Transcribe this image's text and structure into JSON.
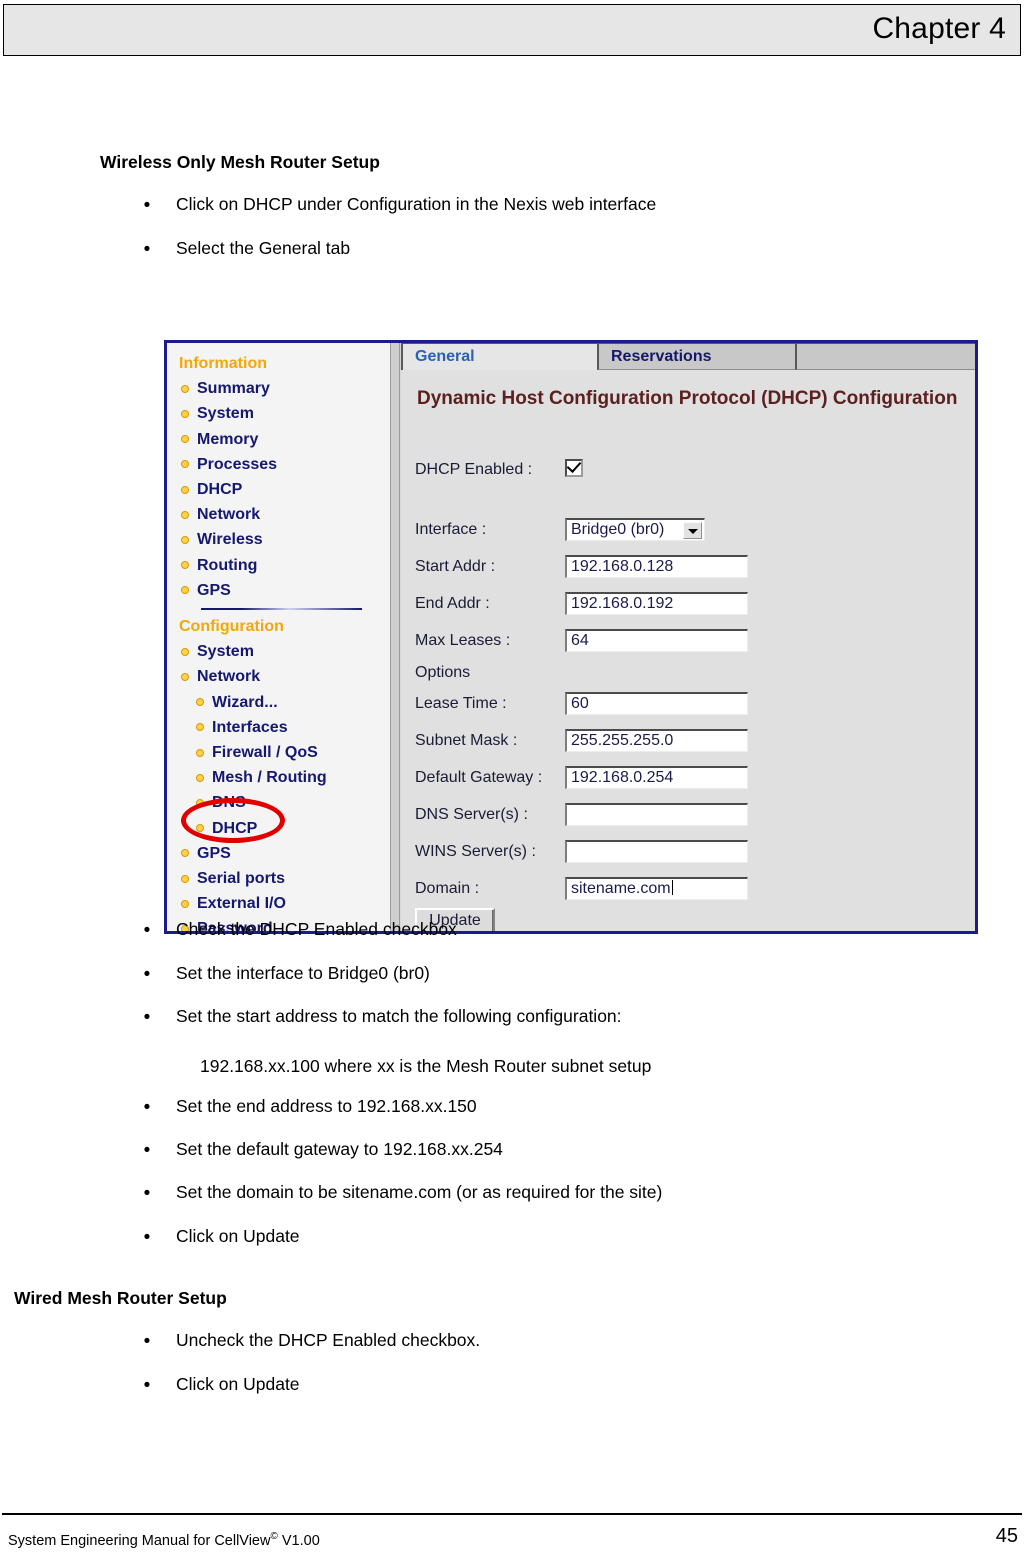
{
  "header": {
    "chapter_label": "Chapter 4"
  },
  "sections": {
    "wireless": {
      "heading": "Wireless Only Mesh Router Setup",
      "pre_bullets": [
        "Click on DHCP under Configuration in the Nexis web interface",
        "Select the General tab"
      ],
      "post_bullets": [
        "Check the DHCP Enabled checkbox",
        "Set the interface to Bridge0 (br0)",
        "Set the start address to match the following configuration:"
      ],
      "sub_note": "192.168.xx.100 where xx is the Mesh Router subnet setup",
      "post_bullets2": [
        "Set the end address to 192.168.xx.150",
        "Set the default gateway to 192.168.xx.254",
        "Set the domain to be sitename.com (or as required for the site)",
        "Click on Update"
      ]
    },
    "wired": {
      "heading": "Wired Mesh Router Setup",
      "bullets": [
        "Uncheck the DHCP Enabled checkbox.",
        "Click on Update"
      ]
    }
  },
  "app_screenshot": {
    "sidebar": {
      "information_title": "Information",
      "information_items": [
        {
          "label": "Summary"
        },
        {
          "label": "System"
        },
        {
          "label": "Memory"
        },
        {
          "label": "Processes"
        },
        {
          "label": "DHCP"
        },
        {
          "label": "Network"
        },
        {
          "label": "Wireless"
        },
        {
          "label": "Routing"
        },
        {
          "label": "GPS"
        }
      ],
      "configuration_title": "Configuration",
      "configuration_items": [
        {
          "label": "System",
          "sub": false
        },
        {
          "label": "Network",
          "sub": false
        },
        {
          "label": "Wizard...",
          "sub": true
        },
        {
          "label": "Interfaces",
          "sub": true
        },
        {
          "label": "Firewall / QoS",
          "sub": true
        },
        {
          "label": "Mesh / Routing",
          "sub": true
        },
        {
          "label": "DNS",
          "sub": true
        },
        {
          "label": "DHCP",
          "sub": true
        },
        {
          "label": "GPS",
          "sub": false
        },
        {
          "label": "Serial ports",
          "sub": false
        },
        {
          "label": "External I/O",
          "sub": false
        },
        {
          "label": "Password",
          "sub": false
        }
      ],
      "annotation_color": "#e00000",
      "annotated_item": "DHCP"
    },
    "tabs": [
      {
        "label": "General",
        "active": true
      },
      {
        "label": "Reservations",
        "active": false
      }
    ],
    "form": {
      "title": "Dynamic Host Configuration Protocol (DHCP) Configuration",
      "dhcp_enabled_label": "DHCP Enabled :",
      "dhcp_enabled_checked": true,
      "interface_label": "Interface :",
      "interface_value": "Bridge0 (br0)",
      "start_addr_label": "Start Addr :",
      "start_addr_value": "192.168.0.128",
      "end_addr_label": "End Addr :",
      "end_addr_value": "192.168.0.192",
      "max_leases_label": "Max Leases :",
      "max_leases_value": "64",
      "options_label": "Options",
      "lease_time_label": "Lease Time :",
      "lease_time_value": "60",
      "subnet_mask_label": "Subnet Mask :",
      "subnet_mask_value": "255.255.255.0",
      "default_gateway_label": "Default Gateway :",
      "default_gateway_value": "192.168.0.254",
      "dns_servers_label": "DNS Server(s) :",
      "dns_servers_value": "",
      "wins_servers_label": "WINS Server(s) :",
      "wins_servers_value": "",
      "domain_label": "Domain :",
      "domain_value": "sitename.com",
      "update_button": "Update"
    }
  },
  "footer": {
    "manual_prefix": "System Engineering Manual for CellView",
    "copyright_mark": "©",
    "version": " V1.00",
    "page_number": "45"
  }
}
